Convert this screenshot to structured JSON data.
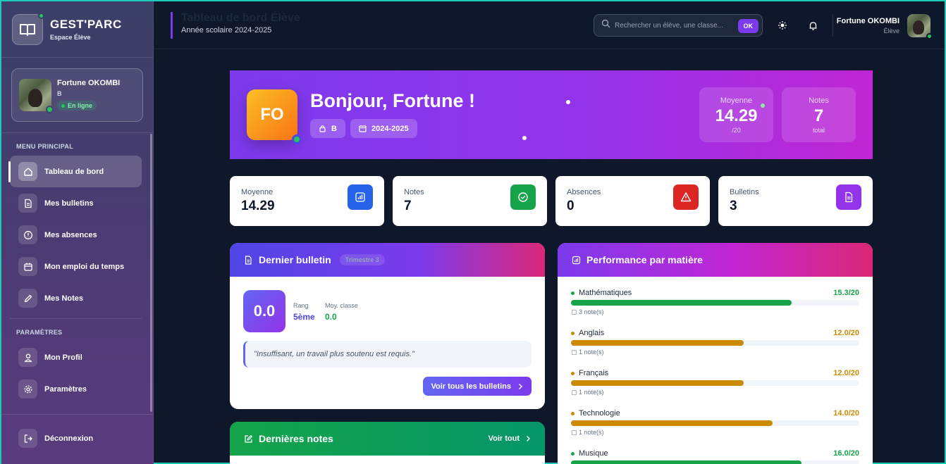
{
  "brand": {
    "title": "GEST'PARC",
    "subtitle": "Espace Élève"
  },
  "profile": {
    "name": "Fortune OKOMBI",
    "class": "B",
    "status": "En ligne"
  },
  "nav": {
    "section_main": "MENU PRINCIPAL",
    "items": [
      {
        "label": "Tableau de bord",
        "icon": "home-icon",
        "active": true
      },
      {
        "label": "Mes bulletins",
        "icon": "document-icon"
      },
      {
        "label": "Mes absences",
        "icon": "alert-circle-icon"
      },
      {
        "label": "Mon emploi du temps",
        "icon": "calendar-icon"
      },
      {
        "label": "Mes Notes",
        "icon": "pencil-icon"
      }
    ],
    "section_settings": "PARAMÈTRES",
    "settings_items": [
      {
        "label": "Mon Profil",
        "icon": "user-icon"
      },
      {
        "label": "Paramètres",
        "icon": "gear-icon"
      }
    ],
    "logout": "Déconnexion"
  },
  "header": {
    "title": "Tableau de bord Élève",
    "subtitle": "Année scolaire 2024-2025",
    "search_placeholder": "Rechercher un élève, une classe...",
    "search_button": "OK",
    "user_name": "Fortune OKOMBI",
    "user_role": "Élève"
  },
  "hero": {
    "initials": "FO",
    "greeting": "Bonjour, Fortune !",
    "class_chip": "B",
    "year_chip": "2024-2025",
    "stats": [
      {
        "label": "Moyenne",
        "value": "14.29",
        "sub": "/20"
      },
      {
        "label": "Notes",
        "value": "7",
        "sub": "total"
      }
    ]
  },
  "kpis": [
    {
      "label": "Moyenne",
      "value": "14.29",
      "icon": "bar-chart-icon",
      "color": "#2563eb"
    },
    {
      "label": "Notes",
      "value": "7",
      "icon": "check-circle-icon",
      "color": "#16a34a"
    },
    {
      "label": "Absences",
      "value": "0",
      "icon": "warning-icon",
      "color": "#dc2626"
    },
    {
      "label": "Bulletins",
      "value": "3",
      "icon": "file-icon",
      "color": "#9333ea"
    }
  ],
  "bulletin": {
    "title": "Dernier bulletin",
    "badge": "Trimestre 3",
    "score": "0.0",
    "rank_label": "Rang",
    "rank_value": "5ème",
    "class_avg_label": "Moy. classe",
    "class_avg_value": "0.0",
    "comment": "\"Insuffisant, un travail plus soutenu est requis.\"",
    "button": "Voir tous les bulletins"
  },
  "notes": {
    "title": "Dernières notes",
    "see_all": "Voir tout"
  },
  "performance": {
    "title": "Performance par matière",
    "subjects": [
      {
        "name": "Mathématiques",
        "score": "15.3/20",
        "count": "3 note(s)",
        "fraction": 0.765,
        "color": "#16a34a"
      },
      {
        "name": "Anglais",
        "score": "12.0/20",
        "count": "1 note(s)",
        "fraction": 0.6,
        "color": "#ca8a04"
      },
      {
        "name": "Français",
        "score": "12.0/20",
        "count": "1 note(s)",
        "fraction": 0.6,
        "color": "#ca8a04"
      },
      {
        "name": "Technologie",
        "score": "14.0/20",
        "count": "1 note(s)",
        "fraction": 0.7,
        "color": "#ca8a04"
      },
      {
        "name": "Musique",
        "score": "16.0/20",
        "count": "",
        "fraction": 0.8,
        "color": "#16a34a"
      }
    ]
  }
}
